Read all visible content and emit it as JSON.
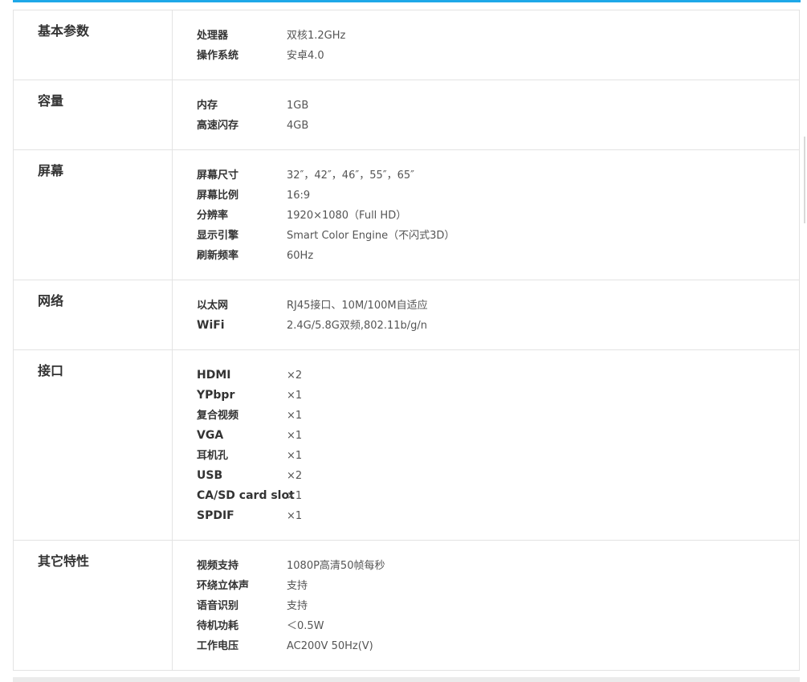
{
  "accent_color": "#1ea8e8",
  "sections": [
    {
      "title": "基本参数",
      "rows": [
        {
          "key": "处理器",
          "value": "双核1.2GHz"
        },
        {
          "key": "操作系统",
          "value": "安卓4.0"
        }
      ]
    },
    {
      "title": "容量",
      "rows": [
        {
          "key": "内存",
          "value": "1GB"
        },
        {
          "key": "高速闪存",
          "value": "4GB"
        }
      ]
    },
    {
      "title": "屏幕",
      "rows": [
        {
          "key": "屏幕尺寸",
          "value": "32″，42″，46″，55″，65″"
        },
        {
          "key": "屏幕比例",
          "value": "16:9"
        },
        {
          "key": "分辨率",
          "value": "1920×1080（Full HD）"
        },
        {
          "key": "显示引擎",
          "value": "Smart Color Engine（不闪式3D）"
        },
        {
          "key": "刷新频率",
          "value": "60Hz"
        }
      ]
    },
    {
      "title": "网络",
      "rows": [
        {
          "key": "以太网",
          "value": "RJ45接口、10M/100M自适应"
        },
        {
          "key": "WiFi",
          "value": "2.4G/5.8G双频,802.11b/g/n"
        }
      ]
    },
    {
      "title": "接口",
      "rows": [
        {
          "key": "HDMI",
          "value": "×2"
        },
        {
          "key": "YPbpr",
          "value": "×1"
        },
        {
          "key": "复合视频",
          "value": "×1"
        },
        {
          "key": "VGA",
          "value": "×1"
        },
        {
          "key": "耳机孔",
          "value": "×1"
        },
        {
          "key": "USB",
          "value": "×2"
        },
        {
          "key": "CA/SD card slot",
          "value": "×1"
        },
        {
          "key": "SPDIF",
          "value": "×1"
        }
      ]
    },
    {
      "title": "其它特性",
      "rows": [
        {
          "key": "视频支持",
          "value": "1080P高清50帧每秒"
        },
        {
          "key": "环绕立体声",
          "value": "支持"
        },
        {
          "key": "语音识别",
          "value": "支持"
        },
        {
          "key": "待机功耗",
          "value": "＜0.5W"
        },
        {
          "key": "工作电压",
          "value": "AC200V 50Hz(V)"
        }
      ]
    }
  ]
}
